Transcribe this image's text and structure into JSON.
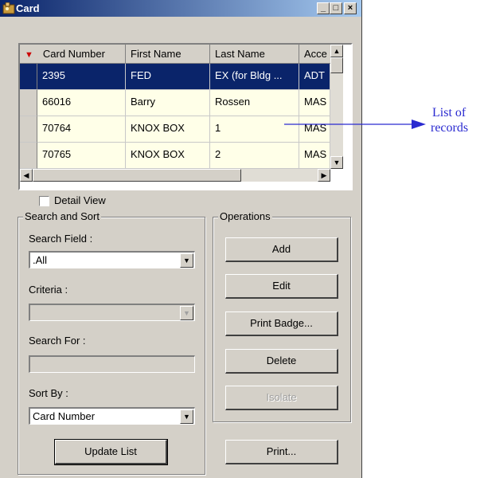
{
  "window": {
    "title": "Card",
    "min_label": "_",
    "max_label": "□",
    "close_label": "×"
  },
  "grid": {
    "columns": [
      "Card Number",
      "First Name",
      "Last Name",
      "Acce"
    ],
    "rows": [
      {
        "card_number": "2395",
        "first_name": "FED",
        "last_name": "EX (for Bldg ...",
        "access": "ADT"
      },
      {
        "card_number": "66016",
        "first_name": "Barry",
        "last_name": "Rossen",
        "access": "MAS"
      },
      {
        "card_number": "70764",
        "first_name": "KNOX BOX",
        "last_name": "1",
        "access": "MAS"
      },
      {
        "card_number": "70765",
        "first_name": "KNOX BOX",
        "last_name": "2",
        "access": "MAS"
      }
    ],
    "selected_row": 0,
    "sort_indicator": "▼"
  },
  "detail_view": {
    "label": "Detail View",
    "checked": false
  },
  "search": {
    "group_label": "Search and Sort",
    "search_field_label": "Search Field :",
    "search_field_value": ".All",
    "criteria_label": "Criteria :",
    "criteria_value": "",
    "search_for_label": "Search For :",
    "search_for_value": "",
    "sort_by_label": "Sort By :",
    "sort_by_value": "Card Number",
    "update_button": "Update List"
  },
  "operations": {
    "group_label": "Operations",
    "add": "Add",
    "edit": "Edit",
    "print_badge": "Print Badge...",
    "delete": "Delete",
    "isolate": "Isolate",
    "print": "Print..."
  },
  "annotation": {
    "line1": "List of",
    "line2": "records"
  },
  "colors": {
    "annotation": "#2a2ad0",
    "selection": "#0a246a",
    "row_bg": "#ffffe8"
  }
}
